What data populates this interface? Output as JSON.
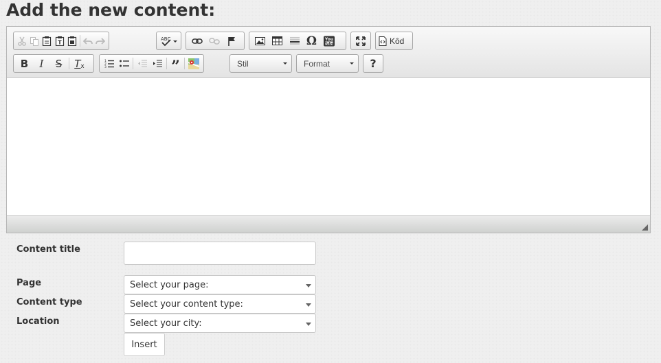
{
  "page_title": "Add the new content:",
  "toolbar": {
    "style_combo": "Stil",
    "format_combo": "Format",
    "source_button": "Kôd",
    "help_button": "?"
  },
  "form": {
    "content_title_label": "Content title",
    "content_title_value": "",
    "page_label": "Page",
    "page_select": "Select your page:",
    "content_type_label": "Content type",
    "content_type_select": "Select your content type:",
    "location_label": "Location",
    "location_select": "Select your city:",
    "insert_button": "Insert"
  }
}
